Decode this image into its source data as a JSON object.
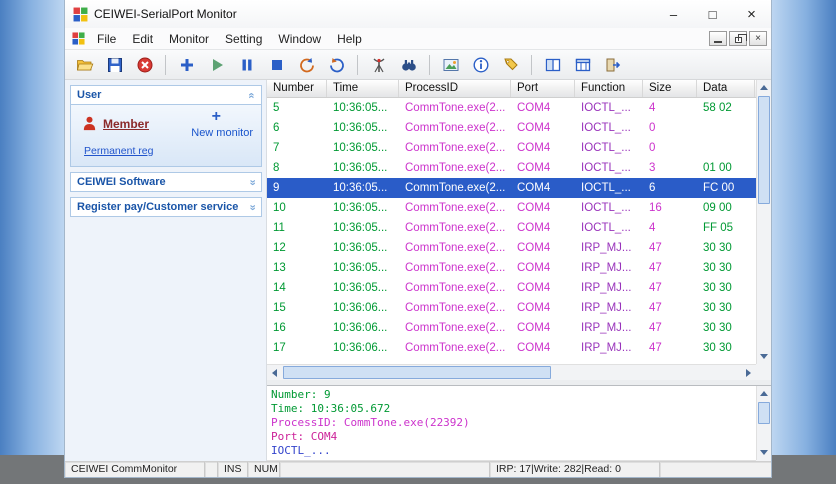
{
  "window": {
    "title": "CEIWEI-SerialPort Monitor",
    "controls": {
      "minimize": "–",
      "maximize": "□",
      "close": "×"
    },
    "mdi_close": "×"
  },
  "menubar": {
    "items": [
      "File",
      "Edit",
      "Monitor",
      "Setting",
      "Window",
      "Help"
    ]
  },
  "toolbar": {
    "icons": [
      "open-file",
      "save",
      "stop-monitor",
      "add-monitor",
      "start-monitor",
      "pause-monitor",
      "stop-capture",
      "undo-arrow",
      "redo-arrow",
      "antenna",
      "find",
      "snapshot",
      "info",
      "tags",
      "split-view",
      "column-view",
      "exit"
    ]
  },
  "sidebar": {
    "sections": [
      {
        "label": "User",
        "expanded": true
      },
      {
        "label": "CEIWEI Software",
        "expanded": false
      },
      {
        "label": "Register pay/Customer service",
        "expanded": false
      }
    ],
    "member": "Member",
    "plus": "+",
    "new_monitor": "New monitor",
    "permanent_reg": "Permanent reg",
    "chevron": "»"
  },
  "table": {
    "columns": [
      "Number",
      "Time",
      "ProcessID",
      "Port",
      "Function",
      "Size",
      "Data"
    ],
    "rows": [
      {
        "n": "5",
        "time": "10:36:05...",
        "process": "CommTone.exe(2...",
        "port": "COM4",
        "func": "IOCTL_...",
        "size": "4",
        "data": "58 02",
        "selected": false
      },
      {
        "n": "6",
        "time": "10:36:05...",
        "process": "CommTone.exe(2...",
        "port": "COM4",
        "func": "IOCTL_...",
        "size": "0",
        "data": "",
        "selected": false
      },
      {
        "n": "7",
        "time": "10:36:05...",
        "process": "CommTone.exe(2...",
        "port": "COM4",
        "func": "IOCTL_...",
        "size": "0",
        "data": "",
        "selected": false
      },
      {
        "n": "8",
        "time": "10:36:05...",
        "process": "CommTone.exe(2...",
        "port": "COM4",
        "func": "IOCTL_...",
        "size": "3",
        "data": "01 00",
        "selected": false
      },
      {
        "n": "9",
        "time": "10:36:05...",
        "process": "CommTone.exe(2...",
        "port": "COM4",
        "func": "IOCTL_...",
        "size": "6",
        "data": "FC 00",
        "selected": true
      },
      {
        "n": "10",
        "time": "10:36:05...",
        "process": "CommTone.exe(2...",
        "port": "COM4",
        "func": "IOCTL_...",
        "size": "16",
        "data": "09 00",
        "selected": false
      },
      {
        "n": "11",
        "time": "10:36:05...",
        "process": "CommTone.exe(2...",
        "port": "COM4",
        "func": "IOCTL_...",
        "size": "4",
        "data": "FF 05",
        "selected": false
      },
      {
        "n": "12",
        "time": "10:36:05...",
        "process": "CommTone.exe(2...",
        "port": "COM4",
        "func": "IRP_MJ...",
        "size": "47",
        "data": "30 30",
        "selected": false
      },
      {
        "n": "13",
        "time": "10:36:05...",
        "process": "CommTone.exe(2...",
        "port": "COM4",
        "func": "IRP_MJ...",
        "size": "47",
        "data": "30 30",
        "selected": false
      },
      {
        "n": "14",
        "time": "10:36:05...",
        "process": "CommTone.exe(2...",
        "port": "COM4",
        "func": "IRP_MJ...",
        "size": "47",
        "data": "30 30",
        "selected": false
      },
      {
        "n": "15",
        "time": "10:36:06...",
        "process": "CommTone.exe(2...",
        "port": "COM4",
        "func": "IRP_MJ...",
        "size": "47",
        "data": "30 30",
        "selected": false
      },
      {
        "n": "16",
        "time": "10:36:06...",
        "process": "CommTone.exe(2...",
        "port": "COM4",
        "func": "IRP_MJ...",
        "size": "47",
        "data": "30 30",
        "selected": false
      },
      {
        "n": "17",
        "time": "10:36:06...",
        "process": "CommTone.exe(2...",
        "port": "COM4",
        "func": "IRP_MJ...",
        "size": "47",
        "data": "30 30",
        "selected": false
      }
    ]
  },
  "detail": {
    "lines": [
      {
        "text": "Number: 9",
        "color": "#009933"
      },
      {
        "text": "Time: 10:36:05.672",
        "color": "#009933"
      },
      {
        "text": "ProcessID: CommTone.exe(22392)",
        "color": "#cc33cc"
      },
      {
        "text": "Port: COM4",
        "color": "#cc2299"
      },
      {
        "text": "IOCTL_...",
        "color": "#3344cc"
      }
    ]
  },
  "statusbar": {
    "app_name": "CEIWEI CommMonitor",
    "ins": "INS",
    "num": "NUM",
    "counters": "IRP: 17|Write: 282|Read: 0"
  },
  "colors": {
    "selection_bg": "#2a5cc8",
    "number_time_data": "#009933",
    "process_port_size": "#cc33cc",
    "function": "#9933bb",
    "sidebar_header": "#1a55a8",
    "member_text": "#8b2a2a",
    "link": "#2255cc"
  }
}
